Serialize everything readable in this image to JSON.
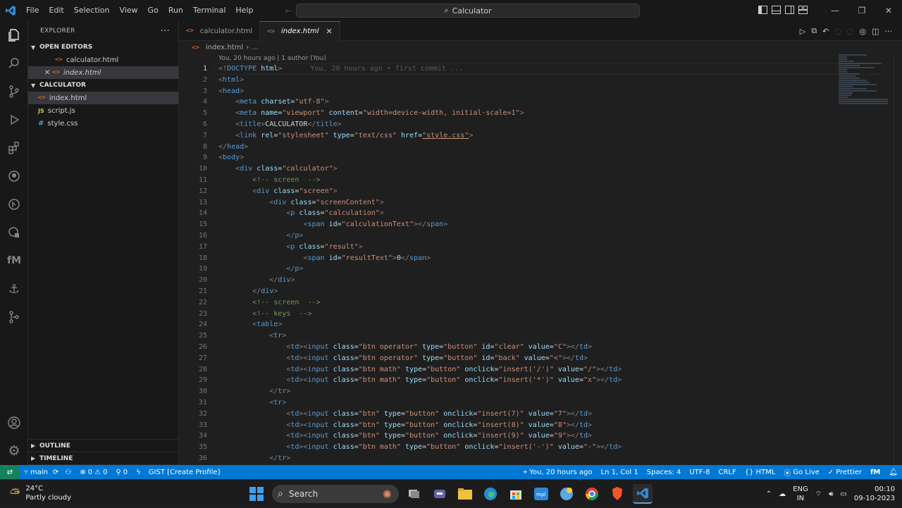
{
  "menu": {
    "items": [
      "File",
      "Edit",
      "Selection",
      "View",
      "Go",
      "Run",
      "Terminal",
      "Help"
    ]
  },
  "command_center": {
    "text": "Calculator"
  },
  "sidebar": {
    "header": "EXPLORER",
    "open_editors": {
      "title": "OPEN EDITORS",
      "items": [
        "calculator.html",
        "index.html"
      ]
    },
    "folder": {
      "title": "CALCULATOR",
      "items": [
        "index.html",
        "script.js",
        "style.css"
      ]
    },
    "outline": "OUTLINE",
    "timeline": "TIMELINE"
  },
  "tabs": [
    {
      "label": "calculator.html"
    },
    {
      "label": "index.html"
    }
  ],
  "breadcrumb": {
    "file": "index.html",
    "more": "..."
  },
  "blame": {
    "text": "You, 20 hours ago | 1 author (You)",
    "ghost": "You, 20 hours ago • first commit ..."
  },
  "code_lines": [
    "<!DOCTYPE html>",
    "<html>",
    "<head>",
    "    <meta charset=\"utf-8\">",
    "    <meta name=\"viewport\" content=\"width=device-width, initial-scale=1\">",
    "    <title>CALCULATOR</title>",
    "    <link rel=\"stylesheet\" type=\"text/css\" href=\"style.css\">",
    "</head>",
    "<body>",
    "    <div class=\"calculator\">",
    "        <!-- screen  -->",
    "        <div class=\"screen\">",
    "            <div class=\"screenContent\">",
    "                <p class=\"calculation\">",
    "                    <span id=\"calculationText\"></span>",
    "                </p>",
    "                <p class=\"result\">",
    "                    <span id=\"resultText\">0</span>",
    "                </p>",
    "            </div>",
    "        </div>",
    "        <!-- screen  -->",
    "        <!-- keys  -->",
    "        <table>",
    "            <tr>",
    "                <td><input class=\"btn operator\" type=\"button\" id=\"clear\" value=\"C\"></td>",
    "                <td><input class=\"btn operator\" type=\"button\" id=\"back\" value=\"<\"></td>",
    "                <td><input class=\"btn math\" type=\"button\" onclick=\"insert('/')\" value=\"/\"></td>",
    "                <td><input class=\"btn math\" type=\"button\" onclick=\"insert('*')\" value=\"x\"></td>",
    "            </tr>",
    "            <tr>",
    "                <td><input class=\"btn\" type=\"button\" onclick=\"insert(7)\" value=\"7\"></td>",
    "                <td><input class=\"btn\" type=\"button\" onclick=\"insert(8)\" value=\"8\"></td>",
    "                <td><input class=\"btn\" type=\"button\" onclick=\"insert(9)\" value=\"9\"></td>",
    "                <td><input class=\"btn math\" type=\"button\" onclick=\"insert('-')\" value=\"-\"></td>",
    "            </tr>"
  ],
  "status": {
    "branch": "main",
    "errors": "0",
    "warnings": "0",
    "ports": "0",
    "gist": "GIST [Create Profile]",
    "blame": "You, 20 hours ago",
    "position": "Ln 1, Col 1",
    "spaces": "Spaces: 4",
    "encoding": "UTF-8",
    "eol": "CRLF",
    "language": "HTML",
    "golive": "Go Live",
    "prettier": "Prettier"
  },
  "taskbar": {
    "temp": "24°C",
    "weather": "Partly cloudy",
    "search": "Search",
    "lang1": "ENG",
    "lang2": "IN",
    "time": "00:10",
    "date": "09-10-2023"
  },
  "colors": {
    "accent": "#0078d4",
    "status_remote": "#16825d",
    "editor_bg": "#1f1f1f"
  }
}
